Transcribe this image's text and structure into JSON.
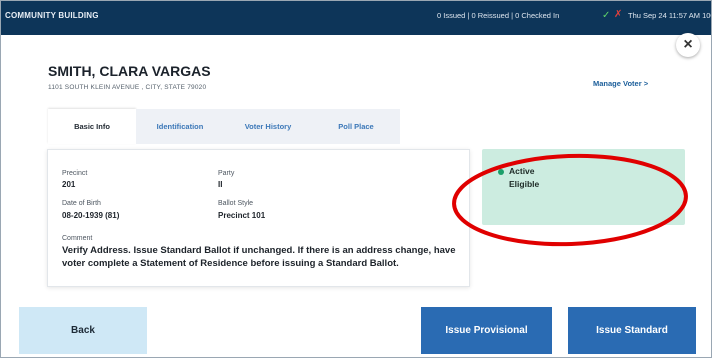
{
  "topbar": {
    "app_name": "COMMUNITY BUILDING",
    "status": "0 Issued | 0 Reissued | 0 Checked In",
    "sync_ok_icon": "check-icon",
    "sync_warn_icon": "warning-icon",
    "clock": "Thu Sep 24 11:57 AM 100%"
  },
  "close_symbol": "×",
  "voter": {
    "name": "SMITH, CLARA VARGAS",
    "address": "1101 SOUTH KLEIN AVENUE , CITY, STATE 79020",
    "manage_link": "Manage Voter >"
  },
  "tabs": [
    {
      "label": "Basic Info",
      "active": true
    },
    {
      "label": "Identification",
      "active": false
    },
    {
      "label": "Voter History",
      "active": false
    },
    {
      "label": "Poll Place",
      "active": false
    }
  ],
  "basic_info": {
    "precinct_label": "Precinct",
    "precinct_value": "201",
    "party_label": "Party",
    "party_value": "II",
    "dob_label": "Date of Birth",
    "dob_value": "08-20-1939 (81)",
    "ballot_style_label": "Ballot Style",
    "ballot_style_value": "Precinct 101",
    "comment_label": "Comment",
    "comment_text": "Verify Address. Issue Standard Ballot if unchanged. If there is an address change, have voter complete a Statement of Residence before issuing a Standard Ballot."
  },
  "status_card": {
    "line1": "Active",
    "line2": "Eligible",
    "dot_color": "#1b9f6a",
    "bg_color": "#ccece0"
  },
  "annotation_color": "#e00000",
  "buttons": {
    "back": "Back",
    "issue_provisional": "Issue Provisional",
    "issue_standard": "Issue Standard"
  },
  "colors": {
    "header_bg": "#0d3559",
    "primary_button": "#2a6bb3",
    "back_button": "#cfe8f6",
    "link": "#1b5e9a"
  }
}
